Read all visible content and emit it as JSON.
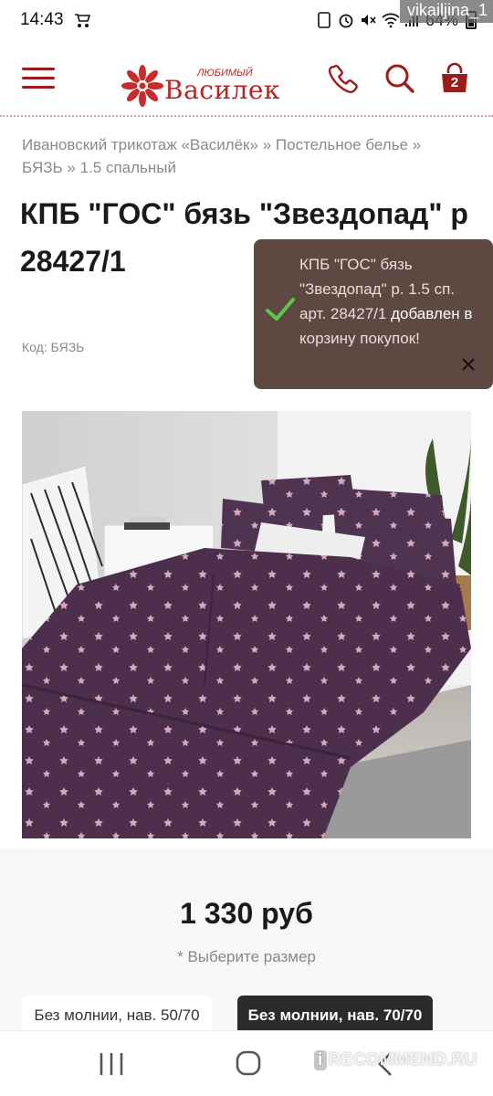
{
  "status_bar": {
    "time": "14:43",
    "battery": "64%",
    "username_watermark": "vikailjina_1"
  },
  "header": {
    "logo_small": "ЛЮБИМЫЙ",
    "logo_big": "Василек",
    "cart_count": "2",
    "brand_color": "#b52626"
  },
  "breadcrumb": {
    "items": [
      "Ивановский трикотаж «Василёк»",
      "Постельное белье",
      "БЯЗЬ",
      "1.5 спальный"
    ],
    "separator": "»"
  },
  "product": {
    "title": "КПБ \"ГОС\" бязь \"Звездопад\" р. 1.5 сп. арт. 28427/1",
    "title_visible": "КПБ \"ГОС\" бязь \"Звездопад\" р 28427/1",
    "sku": "Код: БЯЗЬ",
    "price": "1 330 руб",
    "size_hint": "* Выберите размер",
    "sizes": [
      {
        "label": "Без молнии, нав. 50/70",
        "selected": false
      },
      {
        "label": "Без молнии, нав. 70/70",
        "selected": true
      }
    ]
  },
  "toast": {
    "product_name": "КПБ \"ГОС\" бязь \"Звездопад\" р. 1.5 сп. арт. 28427/1",
    "added_word": "добавлен",
    "in_word": "в",
    "rest": "корзину покупок!",
    "bg_color": "#5e4942"
  },
  "watermark": {
    "site": "RECOMMEND.RU",
    "badge": "i"
  }
}
